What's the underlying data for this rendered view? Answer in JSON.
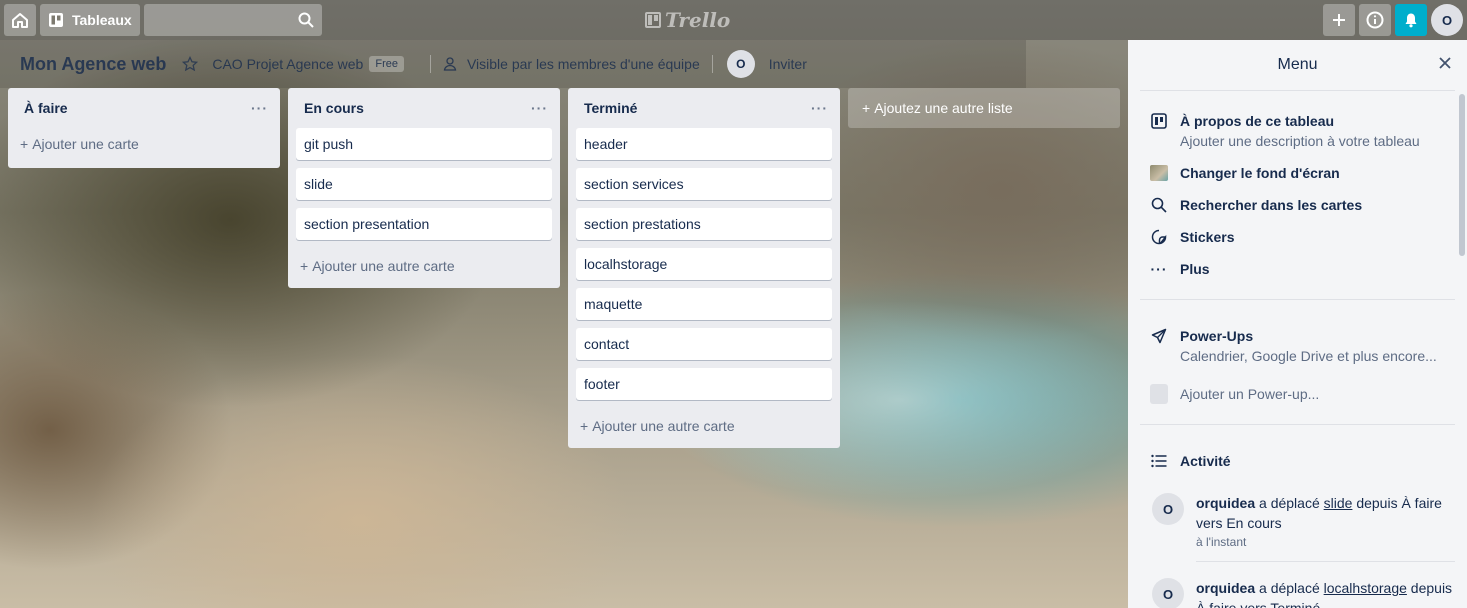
{
  "header": {
    "boards_label": "Tableaux",
    "logo_text": "Trello",
    "user_initial": "O"
  },
  "board": {
    "title": "Mon Agence web",
    "team": "CAO Projet Agence web",
    "plan_badge": "Free",
    "visibility": "Visible par les membres d'une équipe",
    "member_initial": "O",
    "invite_label": "Inviter"
  },
  "lists": [
    {
      "title": "À faire",
      "cards": [],
      "add_label": "Ajouter une carte"
    },
    {
      "title": "En cours",
      "cards": [
        "git push",
        "slide",
        "section presentation"
      ],
      "add_label": "Ajouter une autre carte"
    },
    {
      "title": "Terminé",
      "cards": [
        "header",
        "section services",
        "section prestations",
        "localhstorage",
        "maquette",
        "contact",
        "footer"
      ],
      "add_label": "Ajouter une autre carte"
    }
  ],
  "add_list_label": "Ajoutez une autre liste",
  "menu": {
    "title": "Menu",
    "about": {
      "title": "À propos de ce tableau",
      "sub": "Ajouter une description à votre tableau"
    },
    "background": "Changer le fond d'écran",
    "search": "Rechercher dans les cartes",
    "stickers": "Stickers",
    "more": "Plus",
    "powerups": {
      "title": "Power-Ups",
      "sub": "Calendrier, Google Drive et plus encore..."
    },
    "add_powerup": "Ajouter un Power-up...",
    "activity_title": "Activité",
    "activities": [
      {
        "initial": "O",
        "user": "orquidea",
        "verb": "a déplacé",
        "card": "slide",
        "rest": "depuis À faire vers En cours",
        "time": "à l'instant"
      },
      {
        "initial": "O",
        "user": "orquidea",
        "verb": "a déplacé",
        "card": "localhstorage",
        "rest": "depuis À faire vers Terminé",
        "time": ""
      }
    ]
  }
}
